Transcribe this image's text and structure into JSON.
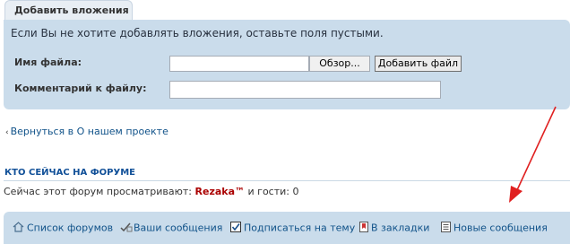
{
  "attachments_tab": {
    "label": "Добавить вложения"
  },
  "attachments_panel": {
    "notice": "Если Вы не хотите добавлять вложения, оставьте поля пустыми.",
    "filename_label": "Имя файла:",
    "browse_button": "Обзор...",
    "add_file_button": "Добавить файл",
    "comment_label": "Комментарий к файлу:"
  },
  "back_link": "Вернуться в О нашем проекте",
  "online": {
    "title": "КТО СЕЙЧАС НА ФОРУМЕ",
    "prefix": "Сейчас этот форум просматривают:",
    "user": "Rezaka™",
    "suffix": "и гости: 0"
  },
  "bottom_nav": {
    "items": [
      {
        "label": "Список форумов",
        "icon": "home-icon"
      },
      {
        "label": "Ваши сообщения",
        "icon": "posts-icon"
      },
      {
        "label": "Подписаться на тему",
        "icon": "checkbox-icon"
      },
      {
        "label": "В закладки",
        "icon": "bookmark-icon"
      },
      {
        "label": "Новые сообщения",
        "icon": "new-posts-icon"
      }
    ]
  },
  "annotation": {
    "arrow_color": "#e02020"
  }
}
